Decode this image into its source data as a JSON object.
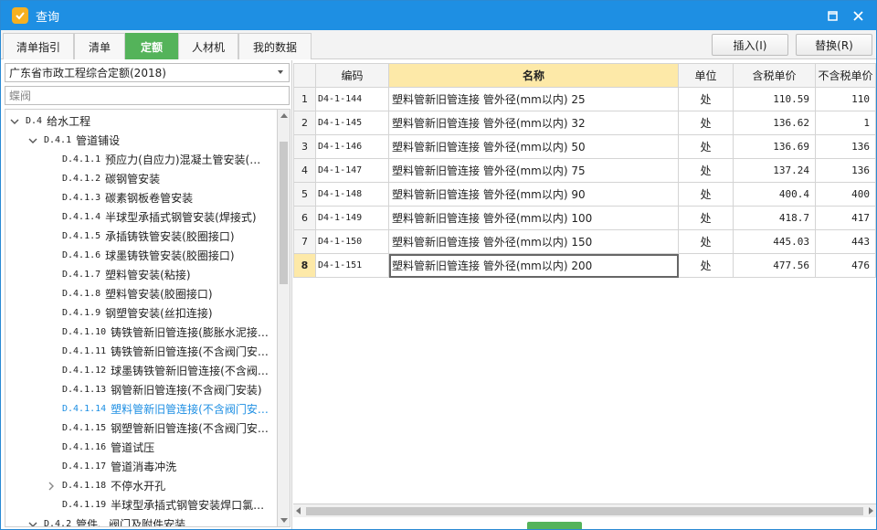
{
  "window": {
    "title": "查询"
  },
  "tabs": [
    {
      "label": "清单指引"
    },
    {
      "label": "清单"
    },
    {
      "label": "定额"
    },
    {
      "label": "人材机"
    },
    {
      "label": "我的数据"
    }
  ],
  "toolbar": {
    "insert_label": "插入(I)",
    "replace_label": "替换(R)"
  },
  "library_select": {
    "value": "广东省市政工程综合定额(2018)"
  },
  "search": {
    "value": "蝶阀"
  },
  "tree": [
    {
      "code": "D.4",
      "label": "给水工程",
      "expanded": true
    },
    {
      "code": "D.4.1",
      "label": "管道铺设",
      "expanded": true
    },
    {
      "code": "D.4.1.1",
      "label": "预应力(自应力)混凝土管安装(…"
    },
    {
      "code": "D.4.1.2",
      "label": "碳钢管安装"
    },
    {
      "code": "D.4.1.3",
      "label": "碳素钢板卷管安装"
    },
    {
      "code": "D.4.1.4",
      "label": "半球型承插式钢管安装(焊接式)"
    },
    {
      "code": "D.4.1.5",
      "label": "承插铸铁管安装(胶圈接口)"
    },
    {
      "code": "D.4.1.6",
      "label": "球墨铸铁管安装(胶圈接口)"
    },
    {
      "code": "D.4.1.7",
      "label": "塑料管安装(粘接)"
    },
    {
      "code": "D.4.1.8",
      "label": "塑料管安装(胶圈接口)"
    },
    {
      "code": "D.4.1.9",
      "label": "钢塑管安装(丝扣连接)"
    },
    {
      "code": "D.4.1.10",
      "label": "铸铁管新旧管连接(膨胀水泥接…"
    },
    {
      "code": "D.4.1.11",
      "label": "铸铁管新旧管连接(不含阀门安…"
    },
    {
      "code": "D.4.1.12",
      "label": "球墨铸铁管新旧管连接(不含阀…"
    },
    {
      "code": "D.4.1.13",
      "label": "钢管新旧管连接(不含阀门安装)"
    },
    {
      "code": "D.4.1.14",
      "label": "塑料管新旧管连接(不含阀门安…",
      "selected": true
    },
    {
      "code": "D.4.1.15",
      "label": "钢塑管新旧管连接(不含阀门安…"
    },
    {
      "code": "D.4.1.16",
      "label": "管道试压"
    },
    {
      "code": "D.4.1.17",
      "label": "管道消毒冲洗"
    },
    {
      "code": "D.4.1.18",
      "label": "不停水开孔",
      "collapsed": true
    },
    {
      "code": "D.4.1.19",
      "label": "半球型承插式钢管安装焊口氯…"
    },
    {
      "code": "D.4.2",
      "label": "管件、阀门及附件安装",
      "expanded": true
    }
  ],
  "table": {
    "headers": [
      "",
      "编码",
      "名称",
      "单位",
      "含税单价",
      "不含税单价"
    ],
    "rows": [
      {
        "idx": "1",
        "code": "D4-1-144",
        "name": "塑料管新旧管连接 管外径(mm以内) 25",
        "unit": "处",
        "price": "110.59",
        "price_ex": "110"
      },
      {
        "idx": "2",
        "code": "D4-1-145",
        "name": "塑料管新旧管连接 管外径(mm以内) 32",
        "unit": "处",
        "price": "136.62",
        "price_ex": "1"
      },
      {
        "idx": "3",
        "code": "D4-1-146",
        "name": "塑料管新旧管连接 管外径(mm以内) 50",
        "unit": "处",
        "price": "136.69",
        "price_ex": "136"
      },
      {
        "idx": "4",
        "code": "D4-1-147",
        "name": "塑料管新旧管连接 管外径(mm以内) 75",
        "unit": "处",
        "price": "137.24",
        "price_ex": "136"
      },
      {
        "idx": "5",
        "code": "D4-1-148",
        "name": "塑料管新旧管连接 管外径(mm以内) 90",
        "unit": "处",
        "price": "400.4",
        "price_ex": "400"
      },
      {
        "idx": "6",
        "code": "D4-1-149",
        "name": "塑料管新旧管连接 管外径(mm以内) 100",
        "unit": "处",
        "price": "418.7",
        "price_ex": "417"
      },
      {
        "idx": "7",
        "code": "D4-1-150",
        "name": "塑料管新旧管连接 管外径(mm以内) 150",
        "unit": "处",
        "price": "445.03",
        "price_ex": "443"
      },
      {
        "idx": "8",
        "code": "D4-1-151",
        "name": "塑料管新旧管连接 管外径(mm以内) 200",
        "unit": "处",
        "price": "477.56",
        "price_ex": "476",
        "current": true
      }
    ]
  },
  "colors": {
    "title_bar": "#1e8fe3",
    "active_tab": "#54b35a",
    "header_highlight": "#fde9a8",
    "tree_selected": "#1e8fe3"
  }
}
